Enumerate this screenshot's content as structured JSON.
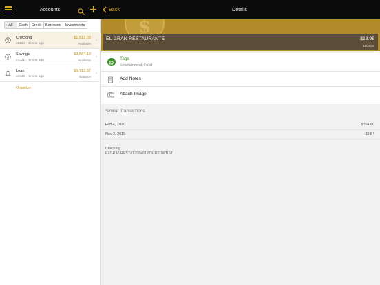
{
  "header": {
    "accounts_title": "Accounts",
    "back_label": "Back",
    "details_title": "Details"
  },
  "colors": {
    "accent": "#d9a827",
    "banner": "#b48b2b",
    "card": "#5b4d38",
    "tag_green": "#3f8f2d",
    "topbar": "#0b0b0b"
  },
  "icons": {
    "menu": "hamburger-menu-icon",
    "search": "search-icon",
    "add": "plus-icon",
    "back": "chevron-left-icon",
    "tags": "tag-icon",
    "notes": "notepad-icon",
    "image": "camera-icon"
  },
  "filters": [
    "All",
    "Cash",
    "Credit",
    "Borrowed",
    "Investments"
  ],
  "filters_active": "All",
  "accounts": [
    {
      "name": "Checking",
      "sub": "x1234 - 4 mins ago",
      "amount": "$1,512.03",
      "status": "Available"
    },
    {
      "name": "Savings",
      "sub": "x4321 - 4 mins ago",
      "amount": "$3,564.13",
      "status": "Available"
    },
    {
      "name": "Loan",
      "sub": "x2345 - 4 mins ago",
      "amount": "$6,712.37",
      "status": "Balance"
    }
  ],
  "organize_label": "Organize",
  "transaction": {
    "name": "EL GRAN RESTAURANTE",
    "amount": "$13.98",
    "date": "11/25/20"
  },
  "details": {
    "tags_label": "Tags",
    "tags_value": "Entertainment, Food",
    "notes_label": "Add Notes",
    "image_label": "Attach Image"
  },
  "similar": {
    "header": "Similar Transactions",
    "rows": [
      {
        "date": "Feb 4, 2020",
        "amount": "$104.80"
      },
      {
        "date": "Nov 2, 2019",
        "amount": "$9.54"
      }
    ]
  },
  "footer": {
    "account": "Checking",
    "description": "ELGRANREST#1298461YOURTOWNST"
  }
}
